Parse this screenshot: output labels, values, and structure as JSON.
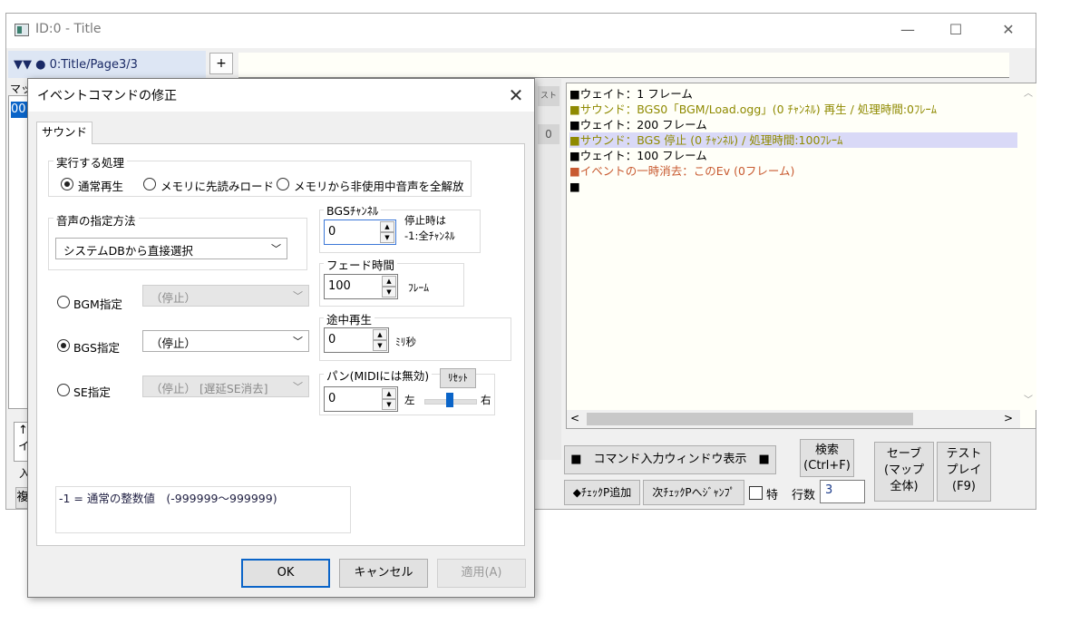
{
  "main_window": {
    "title": "ID:0 - Title",
    "minimize_icon": "—",
    "maximize_icon": "☐",
    "close_icon": "✕",
    "tree_path": "▼▼ ● 0:Title/Page3/3",
    "add_page_label": "+",
    "list_header": "マッ",
    "list_item": "00",
    "left_misc_a": "↑",
    "left_misc_b": "イ",
    "left_misc_c": "入",
    "left_misc_d": "複",
    "test_fragment": "スト",
    "zero_fragment": "0"
  },
  "event_list": {
    "lines": [
      {
        "text": "■ウェイト：1 フレーム",
        "color": "#000000"
      },
      {
        "text": "■サウンド：BGS0「BGM/Load.ogg」(0 ﾁｬﾝﾈﾙ) 再生 / 処理時間:0ﾌﾚｰﾑ",
        "color": "#8f8a00"
      },
      {
        "text": "■ウェイト：200 フレーム",
        "color": "#000000"
      },
      {
        "text": "■サウンド：BGS 停止 (0 ﾁｬﾝﾈﾙ) / 処理時間:100ﾌﾚｰﾑ",
        "color": "#8f8a00"
      },
      {
        "text": "■ウェイト：100 フレーム",
        "color": "#000000"
      },
      {
        "text": "■イベントの一時消去：このEv (0フレーム)",
        "color": "#c85a30"
      },
      {
        "text": "■",
        "color": "#000000"
      }
    ],
    "selected_index": 3
  },
  "toolbar": {
    "command_window_label": "■　コマンド入力ウィンドウ表示　■",
    "search_label": "検索\n(Ctrl+F)",
    "save_label": "セーブ\n(マップ\n全体)",
    "test_play_label": "テスト\nプレイ\n(F9)",
    "add_checkpoint_label": "◆ﾁｪｯｸP追加",
    "next_checkpoint_label": "次ﾁｪｯｸPへｼﾞｬﾝﾌﾟ",
    "special_label": "特",
    "rows_label": "行数",
    "rows_value": "3"
  },
  "dialog": {
    "title": "イベントコマンドの修正",
    "close_icon": "✕",
    "tab_label": "サウンド",
    "process_group_label": "実行する処理",
    "process_options": [
      "通常再生",
      "メモリに先読みロード",
      "メモリから非使用中音声を全解放"
    ],
    "process_selected": 0,
    "method_group_label": "音声の指定方法",
    "method_value": "システムDBから直接選択",
    "bgm_label": "BGM指定",
    "bgm_value": "（停止）",
    "bgs_label": "BGS指定",
    "bgs_value": "（停止）",
    "se_label": "SE指定",
    "se_value": "（停止） [遅延SE消去]",
    "bgs_channel_label": "BGSﾁｬﾝﾈﾙ",
    "bgs_channel_value": "0",
    "stop_note": "停止時は\n-1:全ﾁｬﾝﾈﾙ",
    "fade_label": "フェード時間",
    "fade_value": "100",
    "fade_unit": "ﾌﾚｰﾑ",
    "midway_label": "途中再生",
    "midway_value": "0",
    "midway_unit": "ﾐﾘ秒",
    "pan_label": "パン(MIDIには無効)",
    "pan_reset_label": "ﾘｾｯﾄ",
    "pan_value": "0",
    "pan_left": "左",
    "pan_right": "右",
    "pan_position": 0.5,
    "memo_text": "-1 = 通常の整数値　(-999999〜999999)",
    "ok_label": "OK",
    "cancel_label": "キャンセル",
    "apply_label": "適用(A)"
  }
}
